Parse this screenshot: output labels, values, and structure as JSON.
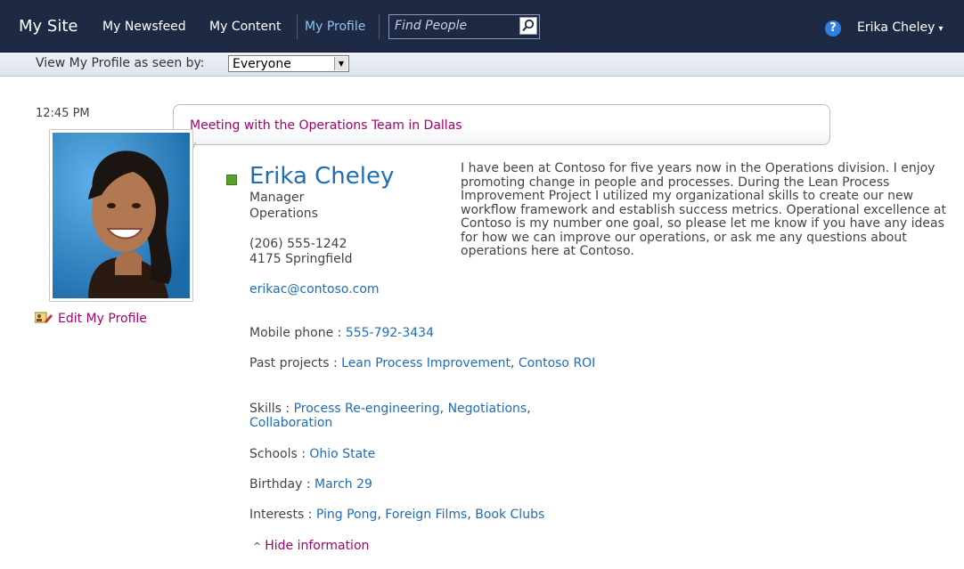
{
  "topbar": {
    "site_title": "My Site",
    "nav": [
      "My Newsfeed",
      "My Content",
      "My Profile"
    ],
    "search_placeholder": "Find People",
    "help_icon": "?",
    "user_name": "Erika Cheley",
    "user_caret": "▾"
  },
  "viewbar": {
    "label": "View My Profile as seen by:",
    "selected": "Everyone"
  },
  "status": {
    "time": "12:45 PM",
    "message": "Meeting with the Operations Team in Dallas"
  },
  "profile": {
    "name": "Erika Cheley",
    "title": "Manager",
    "department": "Operations",
    "phone": "(206) 555-1242",
    "office": "4175 Springfield",
    "email": "erikac@contoso.com",
    "edit_label": "Edit My Profile",
    "bio": "I have been at Contoso for five years now in the Operations division.  I enjoy promoting change in people and processes. During the Lean Process Improvement Project I utilized my organizational skills to create our new workflow framework and establish success metrics. Operational excellence at Contoso is my number one goal, so please let me know if you have any ideas for how we can improve our operations, or ask me any questions about operations here at Contoso."
  },
  "details": {
    "mobile_label": "Mobile phone : ",
    "mobile_value": "555-792-3434",
    "projects_label": "Past projects : ",
    "projects": [
      "Lean Process Improvement",
      "Contoso ROI"
    ],
    "skills_label": "Skills : ",
    "skills": [
      "Process Re-engineering",
      "Negotiations",
      "Collaboration"
    ],
    "schools_label": "Schools : ",
    "schools": [
      "Ohio State"
    ],
    "birthday_label": "Birthday : ",
    "birthday_value": "March 29",
    "interests_label": "Interests : ",
    "interests": [
      "Ping Pong",
      "Foreign Films",
      "Book Clubs"
    ],
    "hide_label": "Hide information"
  },
  "colors": {
    "topbar_bg": "#1e2a44",
    "link_blue": "#1f6cb5",
    "accent_magenta": "#a3006e",
    "presence_green": "#5aa02c"
  }
}
